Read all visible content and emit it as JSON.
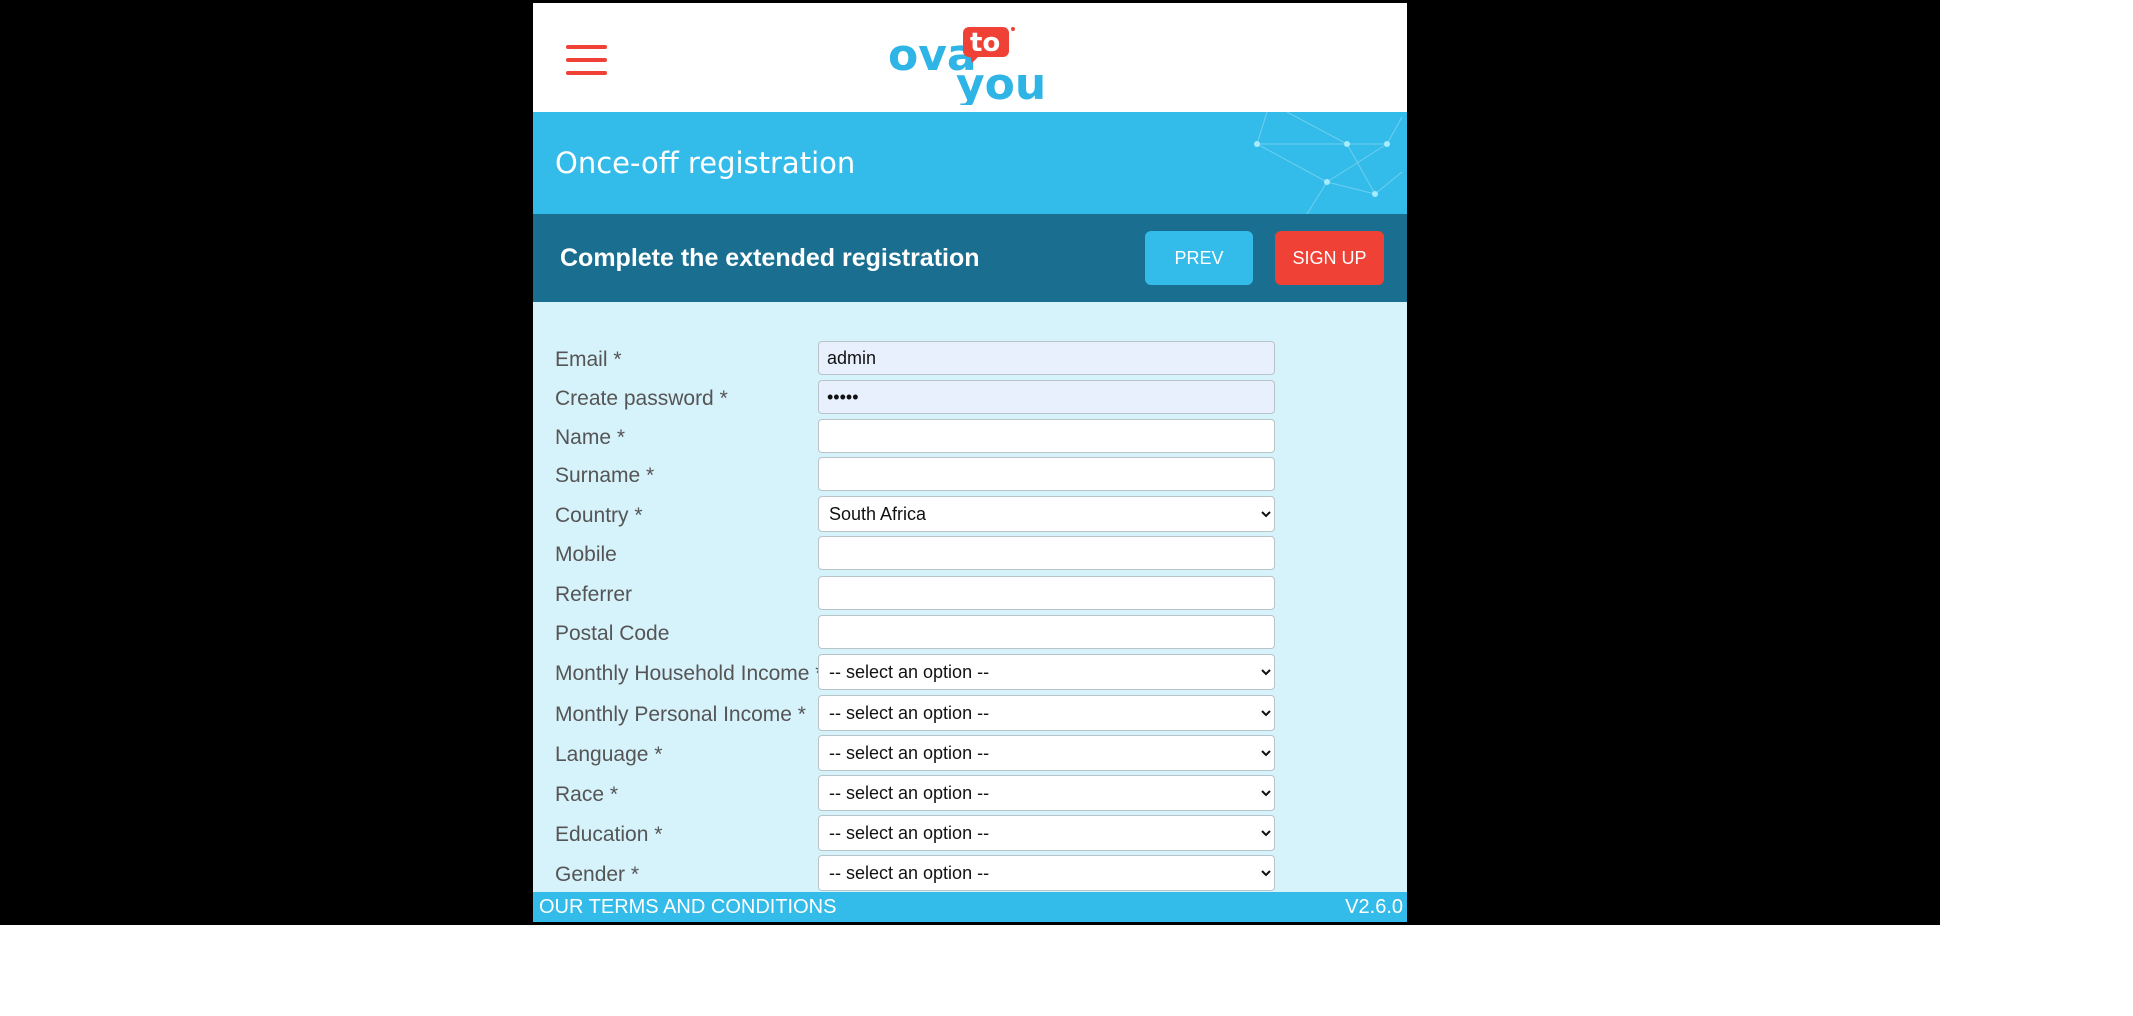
{
  "header": {
    "menu_icon": "hamburger-menu-icon",
    "logo": {
      "main": "ova",
      "badge": "to",
      "bottom": "you"
    }
  },
  "banner": {
    "title": "Once-off registration"
  },
  "subheader": {
    "title": "Complete the extended registration",
    "prev_label": "PREV",
    "signup_label": "SIGN UP"
  },
  "form": {
    "email": {
      "label": "Email *",
      "value": "admin"
    },
    "password": {
      "label": "Create password *",
      "value": "•••••"
    },
    "name": {
      "label": "Name *",
      "value": ""
    },
    "surname": {
      "label": "Surname *",
      "value": ""
    },
    "country": {
      "label": "Country *",
      "value": "South Africa"
    },
    "mobile": {
      "label": "Mobile",
      "value": ""
    },
    "referrer": {
      "label": "Referrer",
      "value": ""
    },
    "postal_code": {
      "label": "Postal Code",
      "value": ""
    },
    "household_income": {
      "label": "Monthly Household Income *",
      "value": "-- select an option --"
    },
    "personal_income": {
      "label": "Monthly Personal Income *",
      "value": "-- select an option --"
    },
    "language": {
      "label": "Language *",
      "value": "-- select an option --"
    },
    "race": {
      "label": "Race *",
      "value": "-- select an option --"
    },
    "education": {
      "label": "Education *",
      "value": "-- select an option --"
    },
    "gender": {
      "label": "Gender *",
      "value": "-- select an option --"
    }
  },
  "footer": {
    "terms": "OUR TERMS AND CONDITIONS",
    "version": "V2.6.0"
  },
  "colors": {
    "accent_blue": "#33bbe9",
    "dark_teal": "#1a6f91",
    "brand_red": "#ef4136",
    "form_bg": "#d6f2fb"
  }
}
